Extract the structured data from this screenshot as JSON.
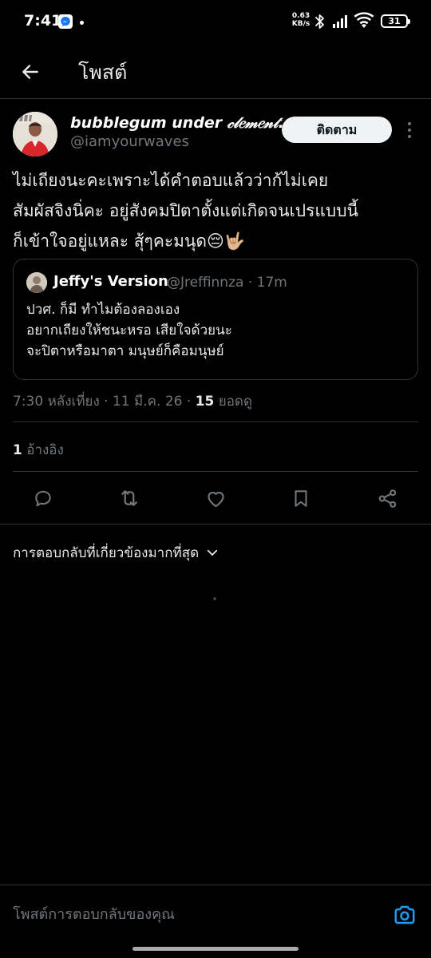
{
  "status_bar": {
    "time": "7:41",
    "net_speed_value": "0.63",
    "net_speed_unit": "KB/s",
    "battery": "31",
    "icons": [
      "messenger-icon",
      "bluetooth-icon",
      "signal-icon",
      "wifi-icon",
      "battery-icon"
    ]
  },
  "header": {
    "title": "โพสต์",
    "back_icon": "arrow-left-icon"
  },
  "post": {
    "author_name": "bubblegum under 𝒸𝓁𝑒𝓂𝑒𝓃𝓉…",
    "author_handle": "@iamyourwaves",
    "follow_label": "ติดตาม",
    "text_line1": "ไม่เถียงนะคะเพราะได้คำตอบแล้วว่าก้ไม่เคย",
    "text_line2": "สัมผัสจิงนิ่คะ อยู่สังคมปิตาตั้งแต่เกิดจนเปรแบบนี้",
    "text_line3": "ก็เข้าใจอยู่แหละ สุ้ๆคะมนุด😔🤟🏼",
    "quote": {
      "author_name": "Jeffy's Version",
      "author_handle": "@Jreffinnza",
      "separator": "·",
      "age": "17m",
      "line1": "ปวศ. ก็มี ทำไมต้องลองเอง",
      "line2": "อยากเถียงให้ชนะหรอ เสียใจด้วยนะ",
      "line3": "จะปิตาหรือมาตา มนุษย์ก็คือมนุษย์"
    },
    "timestamp": "7:30 หลังเที่ยง · 11 มี.ค. 26 · ",
    "views_count": "15",
    "views_label": " ยอดดู",
    "quotes_count": "1",
    "quotes_label": " อ้างอิง"
  },
  "actions": [
    "reply-icon",
    "repost-icon",
    "like-icon",
    "bookmark-icon",
    "share-icon"
  ],
  "replies": {
    "sort_label": "การตอบกลับที่เกี่ยวข้องมากที่สุด"
  },
  "reply_bar": {
    "placeholder": "โพสต์การตอบกลับของคุณ"
  },
  "colors": {
    "background": "#000000",
    "text_primary": "#e7e9ea",
    "text_secondary": "#71767b",
    "divider": "#2f3336",
    "accent": "#1d9bf0",
    "follow_bg": "#eff3f4"
  }
}
